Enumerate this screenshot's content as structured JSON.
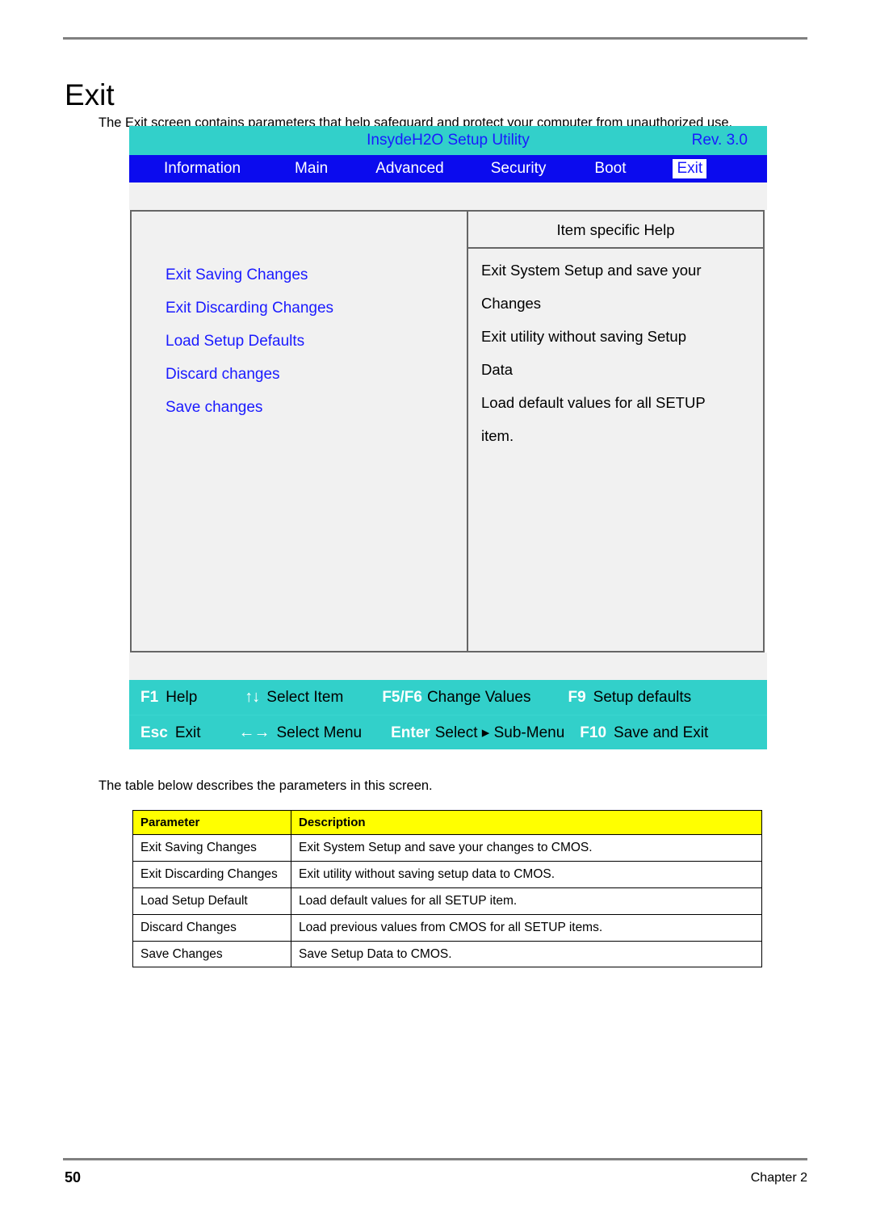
{
  "document": {
    "title": "Exit",
    "intro": "The Exit screen contains parameters that help safeguard and protect your computer from unauthorized use.",
    "mid_text": "The table below describes the parameters in this screen.",
    "footer_page": "50",
    "footer_chapter": "Chapter 2"
  },
  "bios": {
    "utility_title": "InsydeH2O Setup Utility",
    "revision": "Rev. 3.0",
    "menu_tabs": [
      {
        "label": "Information",
        "selected": false
      },
      {
        "label": "Main",
        "selected": false
      },
      {
        "label": "Advanced",
        "selected": false
      },
      {
        "label": "Security",
        "selected": false
      },
      {
        "label": "Boot",
        "selected": false
      },
      {
        "label": "Exit",
        "selected": true
      }
    ],
    "options": [
      "Exit Saving Changes",
      "Exit Discarding Changes",
      "Load Setup Defaults",
      "Discard changes",
      "Save changes"
    ],
    "help_header": "Item specific Help",
    "help_lines": [
      "Exit System Setup and save your",
      "Changes",
      "Exit utility without saving Setup",
      "Data",
      "Load default values for all SETUP",
      "item."
    ],
    "keybar": {
      "row1": [
        {
          "key": "F1",
          "glyph": "",
          "label": "Help"
        },
        {
          "key": "",
          "glyph": "↑↓",
          "label": "Select Item"
        },
        {
          "key": "F5/F6",
          "glyph": "",
          "label": "Change Values"
        },
        {
          "key": "F9",
          "glyph": "",
          "label": "Setup defaults"
        }
      ],
      "row2": [
        {
          "key": "Esc",
          "glyph": "",
          "label": "Exit"
        },
        {
          "key": "",
          "glyph": "←→",
          "label": "Select Menu"
        },
        {
          "key": "Enter",
          "glyph": "",
          "label": "Select ▸ Sub-Menu"
        },
        {
          "key": "F10",
          "glyph": "",
          "label": "Save and Exit"
        }
      ]
    },
    "colors": {
      "titlebar_teal": "#32d0ca",
      "menubar_blue": "#0b0bee",
      "option_blue": "#1a1aff",
      "panel_gray": "#f1f1f1",
      "table_header_yellow": "#ffff00"
    }
  },
  "table": {
    "headers": [
      "Parameter",
      "Description"
    ],
    "rows": [
      {
        "parameter": "Exit Saving Changes",
        "description": "Exit System Setup and save your changes to CMOS."
      },
      {
        "parameter": "Exit Discarding Changes",
        "description": "Exit utility without saving setup data to CMOS."
      },
      {
        "parameter": "Load Setup Default",
        "description": "Load default values for all SETUP item."
      },
      {
        "parameter": "Discard Changes",
        "description": "Load previous values from CMOS for all SETUP items."
      },
      {
        "parameter": "Save Changes",
        "description": "Save Setup Data to CMOS."
      }
    ]
  }
}
